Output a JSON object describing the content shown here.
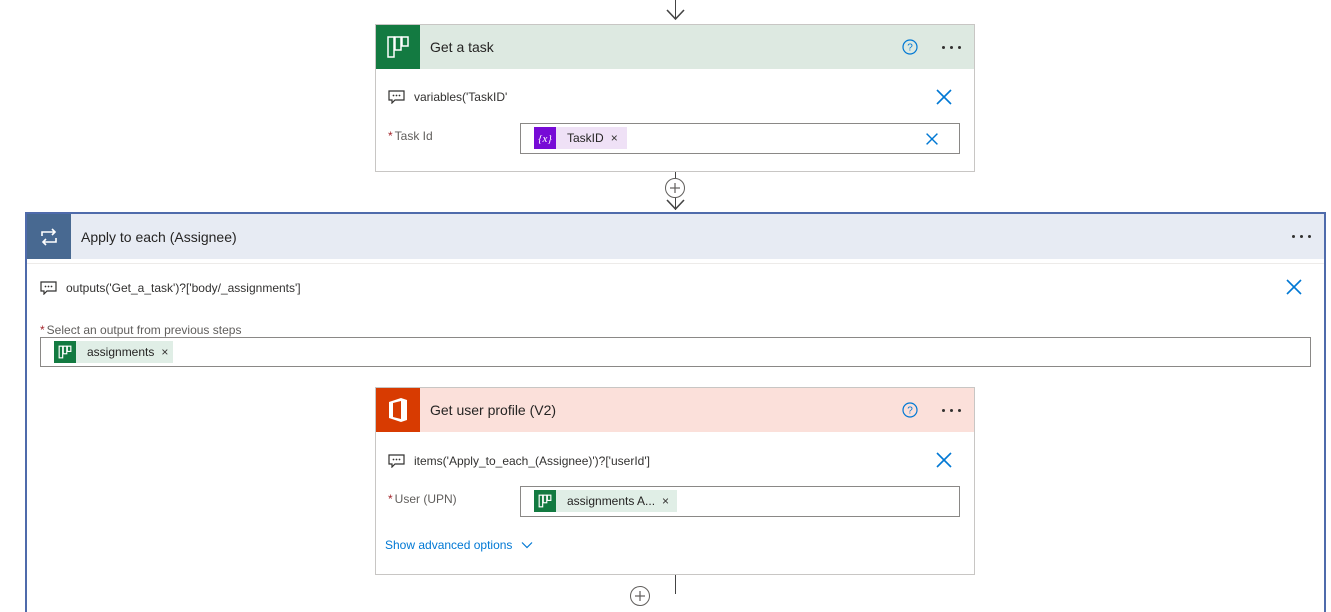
{
  "get_task": {
    "title": "Get a task",
    "comment": "variables('TaskID'",
    "field_label": "Task Id",
    "token": "TaskID",
    "token_x": "×",
    "header_color": "#dde9e1",
    "icon_color": "#137a41"
  },
  "apply_each": {
    "title": "Apply to each (Assignee)",
    "comment": "outputs('Get_a_task')?['body/_assignments']",
    "field_label": "Select an output from previous steps",
    "token": "assignments",
    "token_x": "×",
    "header_color": "#e7ebf3",
    "icon_color": "#486991",
    "border_color": "#4f6bab"
  },
  "get_profile": {
    "title": "Get user profile (V2)",
    "comment": "items('Apply_to_each_(Assignee)')?['userId']",
    "field_label": "User (UPN)",
    "token": "assignments A...",
    "token_x": "×",
    "advanced_link": "Show advanced options",
    "header_color": "#fbe0da",
    "icon_color": "#d83b01"
  },
  "icons": {
    "planner": "planner-icon",
    "variable": "variable-icon",
    "office": "office-icon",
    "loop": "loop-icon",
    "help": "help-icon",
    "more": "more-icon",
    "comment": "comment-icon",
    "close": "close-icon",
    "add": "add-step-icon",
    "chevron": "chevron-down-icon"
  }
}
